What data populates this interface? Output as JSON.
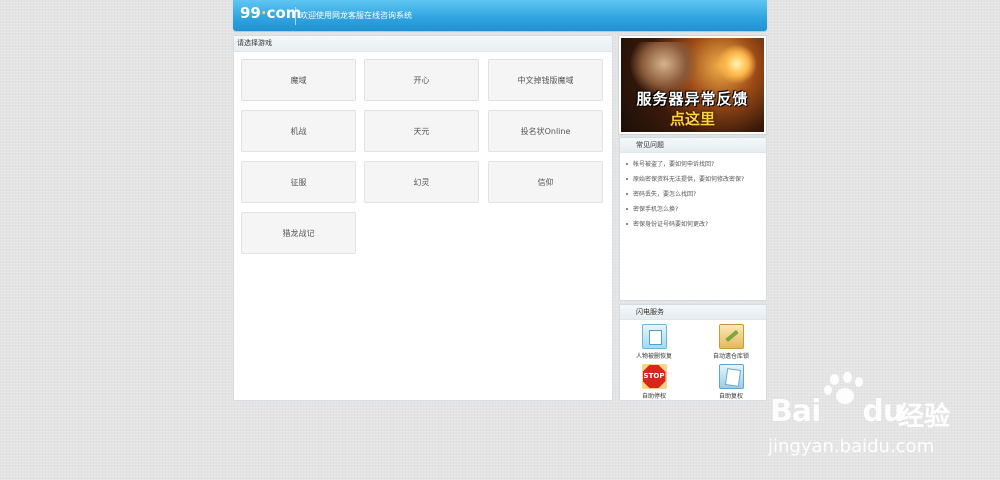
{
  "header": {
    "logo": "99",
    "logo_dot": "·",
    "logo_com": "com",
    "title": "欢迎使用网龙客服在线咨询系统"
  },
  "main": {
    "heading": "请选择游戏",
    "games": [
      "魔域",
      "开心",
      "中文掉钱版魔域",
      "机战",
      "天元",
      "投名状Online",
      "征服",
      "幻灵",
      "信仰",
      "猎龙战记"
    ]
  },
  "banner": {
    "line1": "服务器异常反馈",
    "line2": "点这里"
  },
  "faq": {
    "heading": "常见问题",
    "items": [
      "帐号被盗了，要如何申诉找回?",
      "原始密保资料无法提供，要如何修改密保?",
      "密码丢失，要怎么找回?",
      "密保手机怎么换?",
      "密保身份证号码要如何更改?"
    ]
  },
  "services": {
    "heading": "闪电服务",
    "items": [
      {
        "label": "人物被删恢复",
        "icon": "document-restore-icon"
      },
      {
        "label": "自动遗仓库锁",
        "icon": "key-icon"
      },
      {
        "label": "自助停权",
        "icon": "stop-sign-icon"
      },
      {
        "label": "自助复权",
        "icon": "document-icon"
      }
    ]
  },
  "watermark": {
    "brand_bai": "Bai",
    "brand_du": "du",
    "brand_cn": "经验",
    "url": "jingyan.baidu.com"
  },
  "colors": {
    "header_blue": "#2ea3df",
    "accent_yellow": "#ffd54a"
  }
}
